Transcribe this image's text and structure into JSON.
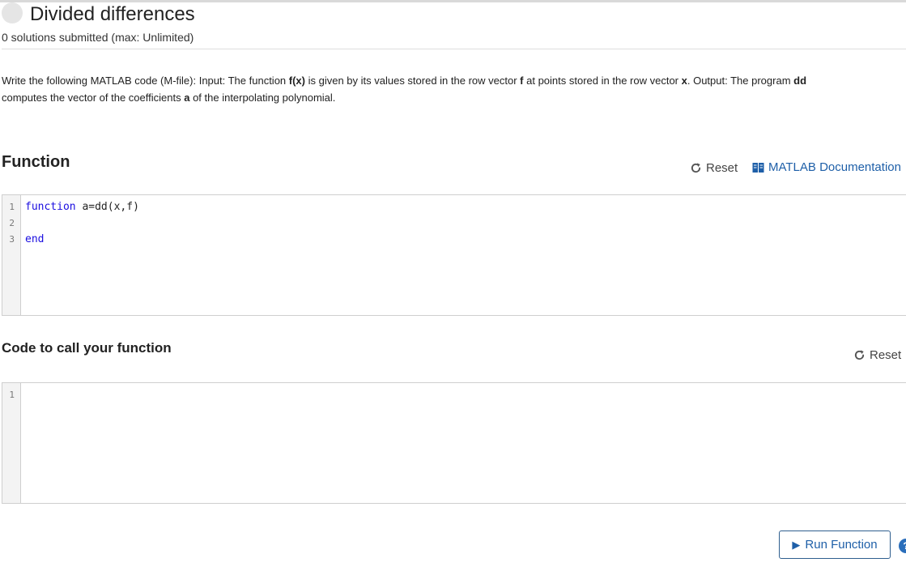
{
  "problem": {
    "title": "Divided differences",
    "submissions": "0 solutions submitted (max: Unlimited)",
    "description": {
      "p1": "Write the following MATLAB code (M-file): Input: The function ",
      "b1": "f(x)",
      "p2": " is given by its values stored in the row vector ",
      "b2": "f",
      "p3": " at points stored in the row vector ",
      "b3": "x",
      "p4": ". Output: The program ",
      "b4": "dd",
      "p5": " computes the vector of the coefficients ",
      "b5": "a",
      "p6": " of the interpolating polynomial."
    }
  },
  "function_section": {
    "heading": "Function",
    "reset_label": "Reset",
    "doc_label": "MATLAB Documentation",
    "lines": [
      {
        "num": "1",
        "kw": "function",
        "text": " a=dd(x,f)"
      },
      {
        "num": "2",
        "kw": "",
        "text": ""
      },
      {
        "num": "3",
        "kw": "end",
        "text": ""
      }
    ]
  },
  "call_section": {
    "heading": "Code to call your function",
    "reset_label": "Reset",
    "lines": [
      {
        "num": "1",
        "text": ""
      }
    ]
  },
  "actions": {
    "run_label": "Run Function",
    "help_glyph": "?"
  },
  "icons": {
    "reset": "refresh-icon",
    "documentation": "book-icon",
    "run": "play-icon",
    "help": "help-icon"
  },
  "colors": {
    "link": "#1e5fa8",
    "keyword": "#1a0de0",
    "gutter": "#f3f3f3"
  }
}
